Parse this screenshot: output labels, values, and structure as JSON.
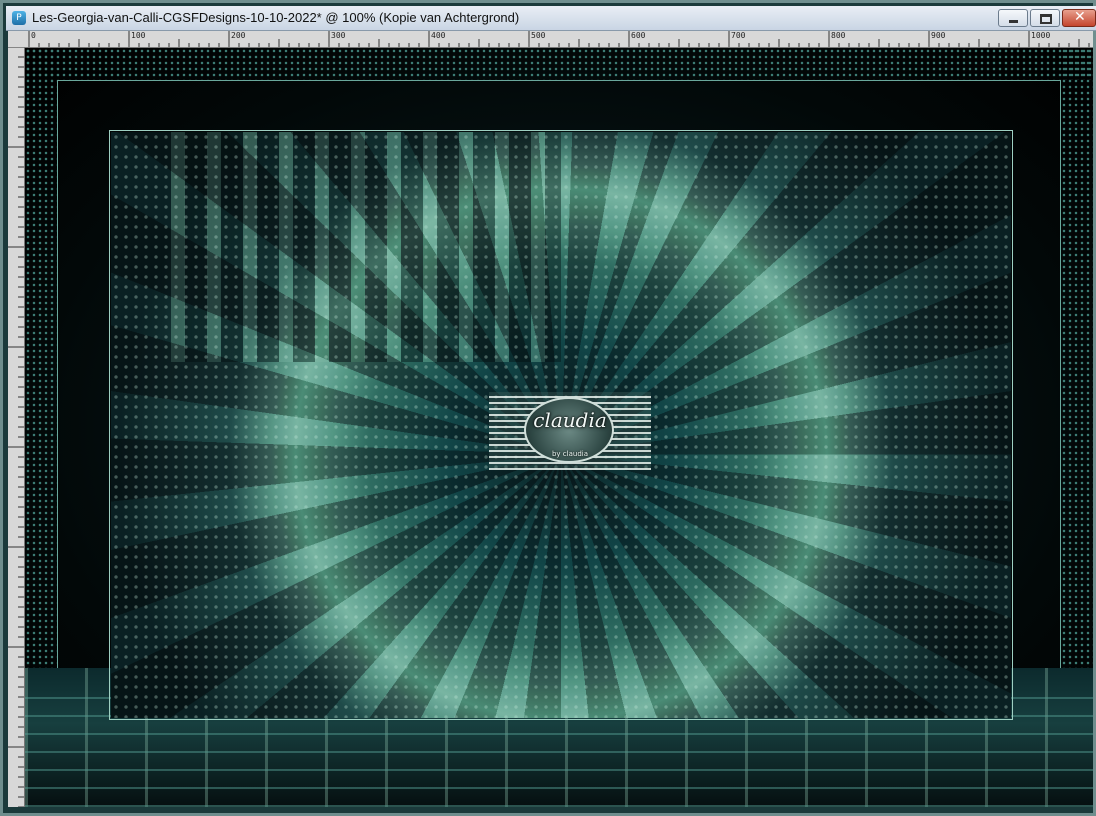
{
  "window": {
    "title": "Les-Georgia-van-Calli-CGSFDesigns-10-10-2022* @ 100% (Kopie van Achtergrond)",
    "app_icon": "psp-icon",
    "buttons": {
      "minimize_icon": "minimize-icon",
      "maximize_icon": "maximize-icon",
      "close_label": "✕"
    }
  },
  "ruler": {
    "horizontal_labels": [
      "0",
      "100",
      "200",
      "300",
      "400",
      "500",
      "600",
      "700",
      "800",
      "900",
      "1000"
    ]
  },
  "canvas": {
    "watermark_text": "claudia",
    "watermark_subtext": "by claudia",
    "colors": {
      "accent": "#6fa593",
      "dark": "#0a1c1f",
      "frame": "#9ed0c2"
    }
  }
}
